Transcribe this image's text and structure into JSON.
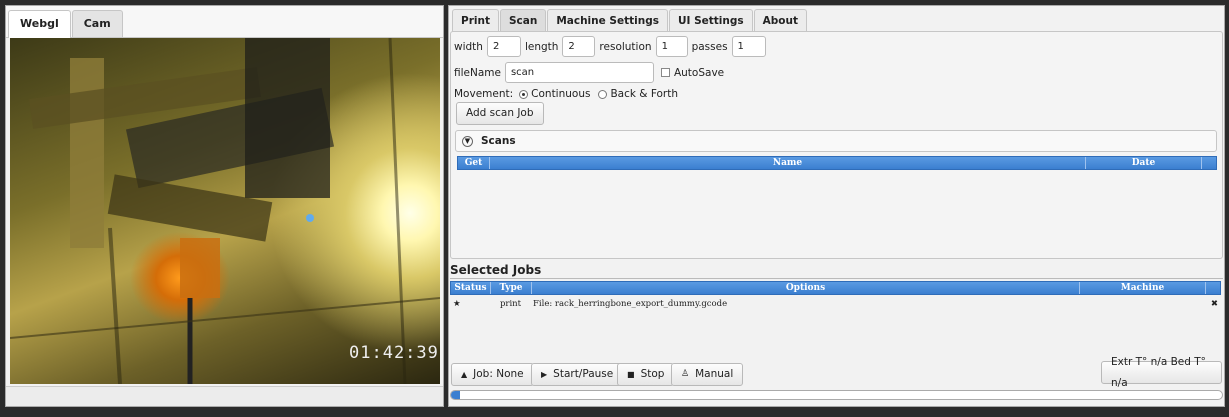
{
  "left": {
    "tabs": [
      {
        "label": "Webgl",
        "active": true
      },
      {
        "label": "Cam",
        "active": false
      }
    ],
    "camera": {
      "timestamp": "01:42:39"
    }
  },
  "right": {
    "tabs": [
      {
        "label": "Print",
        "active": false
      },
      {
        "label": "Scan",
        "active": true
      },
      {
        "label": "Machine Settings",
        "active": false
      },
      {
        "label": "UI Settings",
        "active": false
      },
      {
        "label": "About",
        "active": false
      }
    ],
    "scan": {
      "width_label": "width",
      "width_value": "2",
      "length_label": "length",
      "length_value": "2",
      "resolution_label": "resolution",
      "resolution_value": "1",
      "passes_label": "passes",
      "passes_value": "1",
      "filename_label": "fileName",
      "filename_value": "scan",
      "autosave_label": "AutoSave",
      "autosave_checked": false,
      "movement_label": "Movement:",
      "movement_options": [
        {
          "label": "Continuous",
          "selected": true
        },
        {
          "label": "Back & Forth",
          "selected": false
        }
      ],
      "add_button": "Add scan Job",
      "scans_title": "Scans",
      "scans_columns": [
        "Get",
        "Name",
        "Date"
      ],
      "scans_rows": []
    },
    "selected_jobs": {
      "title": "Selected Jobs",
      "columns": [
        "Status",
        "Type",
        "Options",
        "Machine"
      ],
      "rows": [
        {
          "status": "★",
          "type": "print",
          "options": "File: rack_herringbone_export_dummy.gcode",
          "machine": "",
          "remove": "✖"
        }
      ]
    },
    "toolbar": {
      "job_label": "Job: None",
      "start_pause_label": "Start/Pause",
      "stop_label": "Stop",
      "manual_label": "Manual",
      "temps_label": "Extr T° n/a Bed T° n/a"
    },
    "progress_fraction": 0.012,
    "colors": {
      "accent": "#3b7fd0",
      "panel": "#f2f2f2",
      "background": "#2b2b2b"
    }
  }
}
